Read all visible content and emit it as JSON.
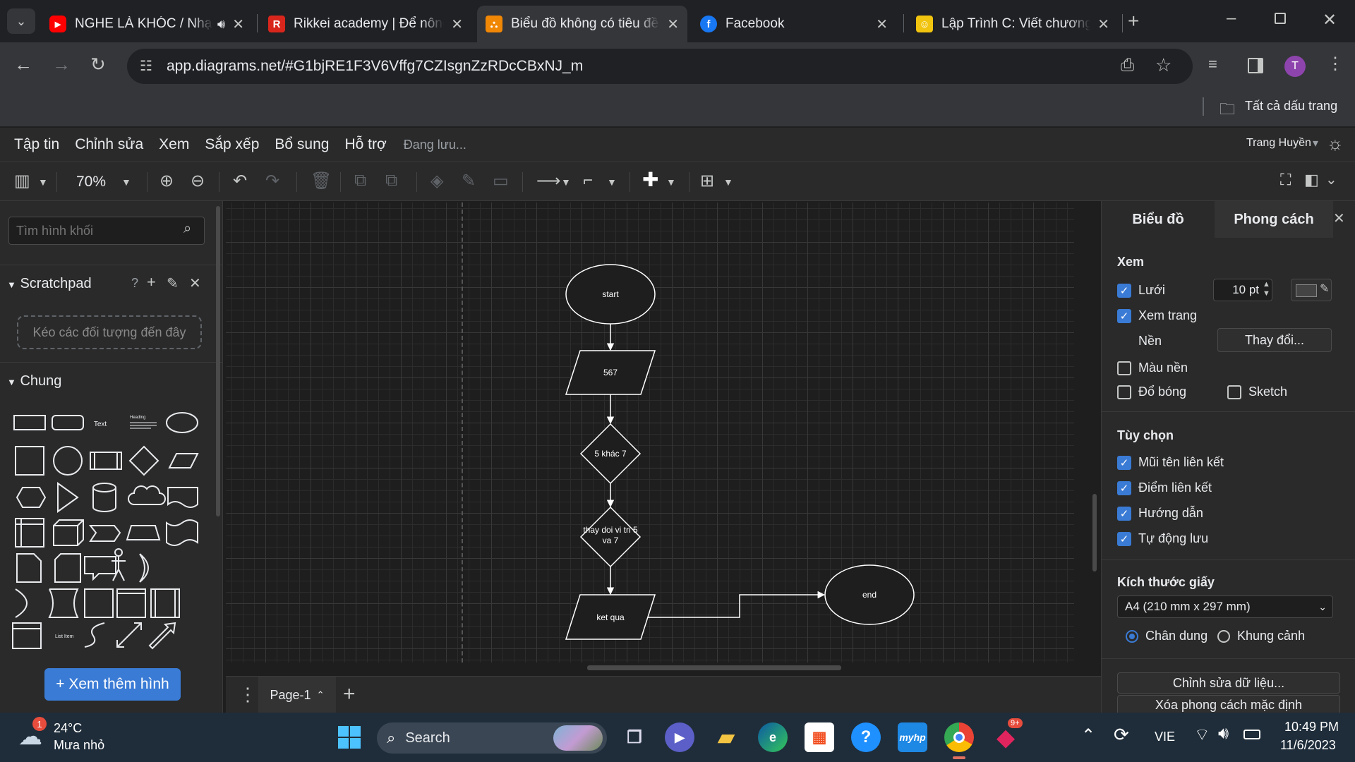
{
  "tabs": [
    {
      "title": "NGHE LÀ KHÓC / Nhạc",
      "active": false,
      "fav_color": "#ff0000"
    },
    {
      "title": "Rikkei academy | Để nông",
      "active": false,
      "fav_color": "#d9261c",
      "fav_glyph": "R"
    },
    {
      "title": "Biểu đồ không có tiêu đề",
      "active": true,
      "fav_color": "#f08705"
    },
    {
      "title": "Facebook",
      "active": false,
      "fav_color": "#1877f2",
      "fav_glyph": "f"
    },
    {
      "title": "Lập Trình C: Viết chương",
      "active": false,
      "fav_color": "#f1c40f"
    }
  ],
  "browser": {
    "url": "app.diagrams.net/#G1bjRE1F3V6Vffg7CZIsgnZzRDcCBxNJ_m",
    "bookmarks_label": "Tất cả dấu trang",
    "profile_initial": "T"
  },
  "menu": {
    "items": [
      "Tập tin",
      "Chỉnh sửa",
      "Xem",
      "Sắp xếp",
      "Bổ sung",
      "Hỗ trợ"
    ],
    "status": "Đang lưu...",
    "user": "Trang Huyền"
  },
  "toolbar": {
    "zoom": "70%"
  },
  "left": {
    "search_placeholder": "Tìm hình khối",
    "scratchpad": "Scratchpad",
    "scratch_icons": "?",
    "drop_text": "Kéo các đối tượng đến đây",
    "general": "Chung",
    "shape_text": "Text",
    "shape_heading": "Heading",
    "shape_listitem": "List Item",
    "more_shapes": "+ Xem thêm hình"
  },
  "diagram": {
    "start": "start",
    "input": "567",
    "decision1": "5 khác 7",
    "decision2_l1": "thay doi vi tri 5",
    "decision2_l2": "va 7",
    "output": "ket qua",
    "end": "end",
    "node_stroke": "#ffffff",
    "node_fill": "#1e1e1e"
  },
  "pages": {
    "current": "Page-1"
  },
  "right": {
    "tab_diagram": "Biểu đồ",
    "tab_style": "Phong cách",
    "view_head": "Xem",
    "grid": {
      "label": "Lưới",
      "checked": true,
      "size": "10 pt"
    },
    "pageview": {
      "label": "Xem trang",
      "checked": true
    },
    "background": {
      "label": "Nền",
      "button": "Thay đổi..."
    },
    "bgcolor": {
      "label": "Màu nền",
      "checked": false
    },
    "shadow": {
      "label": "Đổ bóng",
      "checked": false
    },
    "sketch": {
      "label": "Sketch",
      "checked": false
    },
    "options_head": "Tùy chọn",
    "options": [
      {
        "label": "Mũi tên liên kết",
        "checked": true
      },
      {
        "label": "Điểm liên kết",
        "checked": true
      },
      {
        "label": "Hướng dẫn",
        "checked": true
      },
      {
        "label": "Tự động lưu",
        "checked": true
      }
    ],
    "paper_head": "Kích thước giấy",
    "paper_size": "A4 (210 mm x 297 mm)",
    "portrait": "Chân dung",
    "landscape": "Khung cảnh",
    "edit_data": "Chỉnh sửa dữ liệu...",
    "clear_style": "Xóa phong cách mặc định"
  },
  "taskbar": {
    "temp": "24°C",
    "weather": "Mưa nhỏ",
    "weather_badge": "1",
    "search": "Search",
    "lang": "VIE",
    "time": "10:49 PM",
    "date": "11/6/2023",
    "app_badge": "9+"
  }
}
